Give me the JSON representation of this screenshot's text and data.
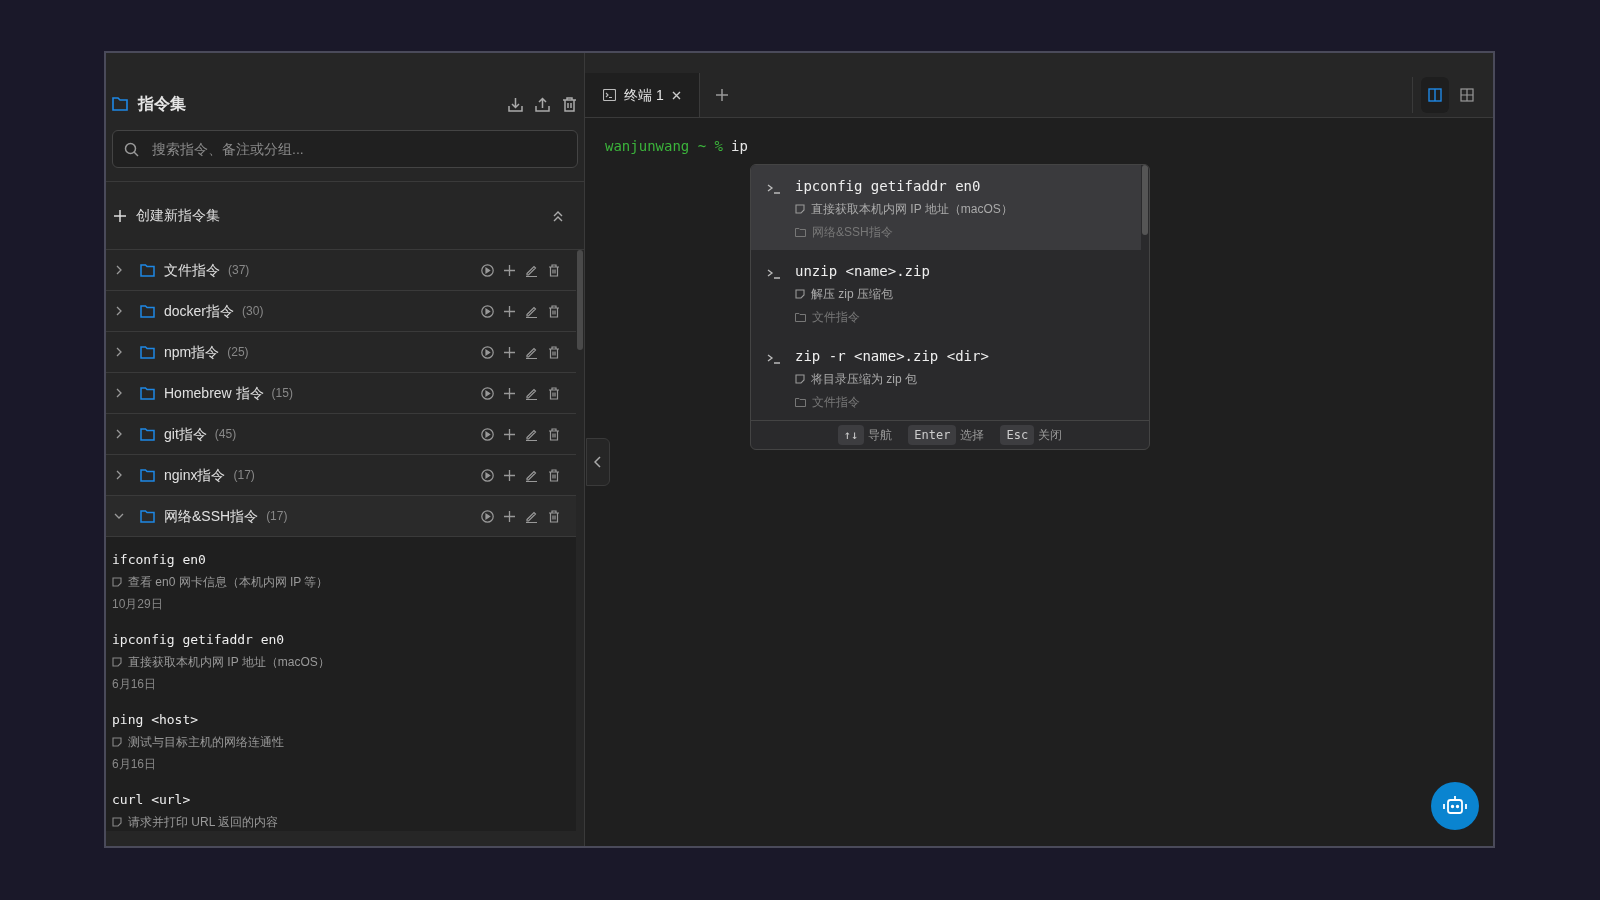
{
  "sidebar": {
    "title": "指令集",
    "search": {
      "placeholder": "搜索指令、备注或分组..."
    },
    "create_label": "创建新指令集",
    "groups": [
      {
        "name": "文件指令",
        "count": "(37)",
        "expanded": false
      },
      {
        "name": "docker指令",
        "count": "(30)",
        "expanded": false
      },
      {
        "name": "npm指令",
        "count": "(25)",
        "expanded": false
      },
      {
        "name": "Homebrew 指令",
        "count": "(15)",
        "expanded": false
      },
      {
        "name": "git指令",
        "count": "(45)",
        "expanded": false
      },
      {
        "name": "nginx指令",
        "count": "(17)",
        "expanded": false
      },
      {
        "name": "网络&SSH指令",
        "count": "(17)",
        "expanded": true,
        "commands": [
          {
            "command": "ifconfig en0",
            "note": "查看 en0 网卡信息（本机内网 IP 等）",
            "date": "10月29日"
          },
          {
            "command": "ipconfig getifaddr en0",
            "note": "直接获取本机内网 IP 地址（macOS）",
            "date": "6月16日"
          },
          {
            "command": "ping <host>",
            "note": "测试与目标主机的网络连通性",
            "date": "6月16日"
          },
          {
            "command": "curl <url>",
            "note": "请求并打印 URL 返回的内容"
          }
        ]
      }
    ]
  },
  "tabs": [
    {
      "label": "终端 1",
      "selected": true
    }
  ],
  "layouts": [
    {
      "kind": "split",
      "selected": true
    },
    {
      "kind": "grid",
      "selected": false
    }
  ],
  "terminal": {
    "prompt": "wanjunwang ~ %",
    "input": "ip"
  },
  "suggestions": [
    {
      "command": "ipconfig getifaddr en0",
      "note": "直接获取本机内网 IP 地址（macOS）",
      "group": "网络&SSH指令",
      "selected": true
    },
    {
      "command": "unzip <name>.zip",
      "note": "解压 zip 压缩包",
      "group": "文件指令",
      "selected": false
    },
    {
      "command": "zip -r <name>.zip <dir>",
      "note": "将目录压缩为 zip 包",
      "group": "文件指令",
      "selected": false
    }
  ],
  "hints": [
    {
      "key": "↑↓",
      "label": "导航"
    },
    {
      "key": "Enter",
      "label": "选择"
    },
    {
      "key": "Esc",
      "label": "关闭"
    }
  ]
}
